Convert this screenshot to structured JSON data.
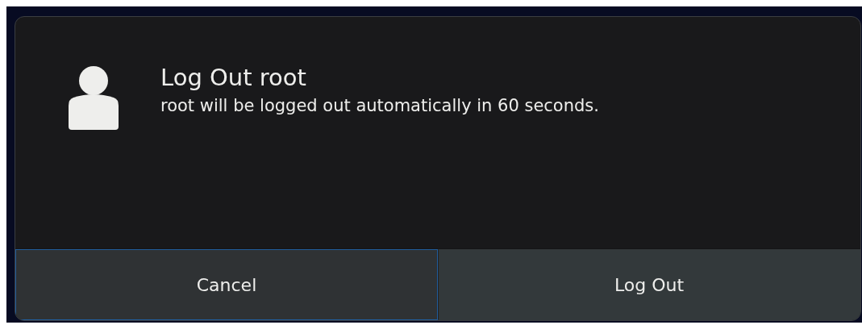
{
  "dialog": {
    "title": "Log Out root",
    "message": "root will be logged out automatically in 60 seconds."
  },
  "buttons": [
    {
      "label": "Cancel",
      "focused": true
    },
    {
      "label": "Log Out",
      "focused": false
    }
  ]
}
